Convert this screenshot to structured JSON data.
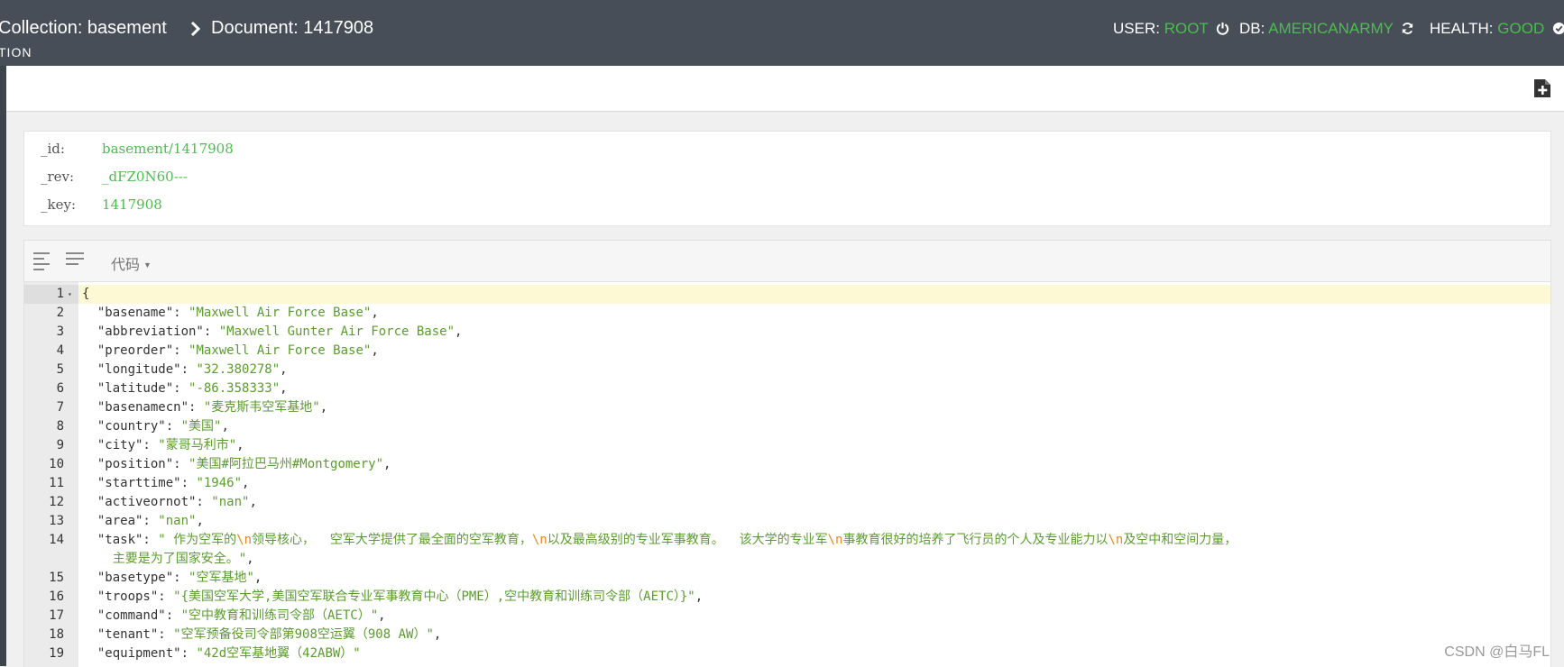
{
  "header": {
    "collection_label": "Collection: basement",
    "document_label": "Document: 1417908",
    "sub_label": "TION",
    "user_label": "USER:",
    "user_value": "ROOT",
    "db_label": "DB:",
    "db_value": "AMERICANARMY",
    "health_label": "HEALTH:",
    "health_value": "GOOD"
  },
  "info": {
    "id_key": "_id:",
    "id_value": "basement/1417908",
    "rev_key": "_rev:",
    "rev_value": "_dFZ0N60---",
    "key_key": "_key:",
    "key_value": "1417908"
  },
  "editor": {
    "mode_label": "代码",
    "lines": [
      {
        "n": "1",
        "t": "{"
      },
      {
        "n": "2",
        "t": "  \"basename\": \"Maxwell Air Force Base\","
      },
      {
        "n": "3",
        "t": "  \"abbreviation\": \"Maxwell Gunter Air Force Base\","
      },
      {
        "n": "4",
        "t": "  \"preorder\": \"Maxwell Air Force Base\","
      },
      {
        "n": "5",
        "t": "  \"longitude\": \"32.380278\","
      },
      {
        "n": "6",
        "t": "  \"latitude\": \"-86.358333\","
      },
      {
        "n": "7",
        "t": "  \"basenamecn\": \"麦克斯韦空军基地\","
      },
      {
        "n": "8",
        "t": "  \"country\": \"美国\","
      },
      {
        "n": "9",
        "t": "  \"city\": \"蒙哥马利市\","
      },
      {
        "n": "10",
        "t": "  \"position\": \"美国#阿拉巴马州#Montgomery\","
      },
      {
        "n": "11",
        "t": "  \"starttime\": \"1946\","
      },
      {
        "n": "12",
        "t": "  \"activeornot\": \"nan\","
      },
      {
        "n": "13",
        "t": "  \"area\": \"nan\","
      },
      {
        "n": "14",
        "t": "  \"task\": \" 作为空军的\\n领导核心，  空军大学提供了最全面的空军教育，\\n以及最高级别的专业军事教育。  该大学的专业军\\n事教育很好的培养了飞行员的个人及专业能力以\\n及空中和空间力量，"
      },
      {
        "n": "",
        "t": "    主要是为了国家安全。\","
      },
      {
        "n": "15",
        "t": "  \"basetype\": \"空军基地\","
      },
      {
        "n": "16",
        "t": "  \"troops\": \"{美国空军大学,美国空军联合专业军事教育中心（PME）,空中教育和训练司令部（AETC）}\","
      },
      {
        "n": "17",
        "t": "  \"command\": \"空中教育和训练司令部（AETC）\","
      },
      {
        "n": "18",
        "t": "  \"tenant\": \"空军预备役司令部第908空运翼（908 AW）\","
      },
      {
        "n": "19",
        "t": "  \"equipment\": \"42d空军基地翼（42ABW）\""
      }
    ]
  },
  "watermark": "CSDN @白马FL",
  "colors": {
    "accent_green": "#4bbd4e",
    "topbar": "#474e57",
    "string": "#5b9c2e",
    "escape": "#e48a1c"
  },
  "icons": [
    "chevron-right-icon",
    "power-icon",
    "refresh-icon",
    "check-circle-icon",
    "add-document-icon",
    "align-left-icon",
    "align-full-icon",
    "fold-arrow-icon"
  ]
}
